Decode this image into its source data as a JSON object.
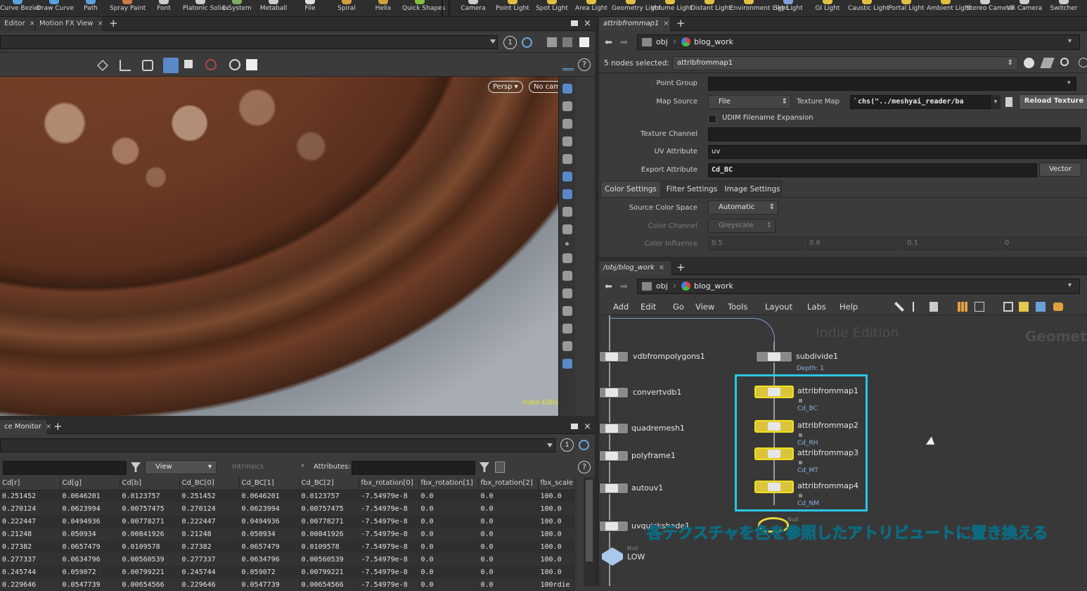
{
  "shelf": {
    "left_tools": [
      {
        "label": "Curve Bezier",
        "color": "#5aa0e0"
      },
      {
        "label": "Draw Curve",
        "color": "#5aa0e0"
      },
      {
        "label": "Path",
        "color": "#5aa0e0"
      },
      {
        "label": "Spray Paint",
        "color": "#d07840"
      },
      {
        "label": "Font",
        "color": "#cccccc"
      },
      {
        "label": "Platonic Solids",
        "color": "#cccccc"
      },
      {
        "label": "L-System",
        "color": "#7ab060"
      },
      {
        "label": "Metaball",
        "color": "#cccccc"
      },
      {
        "label": "File",
        "color": "#dddddd"
      },
      {
        "label": "Spiral",
        "color": "#d0a040"
      },
      {
        "label": "Helix",
        "color": "#d0a040"
      },
      {
        "label": "Quick Shapes",
        "color": "#80c040"
      }
    ],
    "right_tools": [
      {
        "label": "Camera",
        "color": "#cccccc"
      },
      {
        "label": "Point Light",
        "color": "#e0c040"
      },
      {
        "label": "Spot Light",
        "color": "#e0c040"
      },
      {
        "label": "Area Light",
        "color": "#e0c040"
      },
      {
        "label": "Geometry Light",
        "color": "#e0c040"
      },
      {
        "label": "Volume Light",
        "color": "#e0c040"
      },
      {
        "label": "Distant Light",
        "color": "#e0c040"
      },
      {
        "label": "Environment Light",
        "color": "#e0c040"
      },
      {
        "label": "Sky Light",
        "color": "#80a0e0"
      },
      {
        "label": "GI Light",
        "color": "#e0c040"
      },
      {
        "label": "Caustic Light",
        "color": "#e0c040"
      },
      {
        "label": "Portal Light",
        "color": "#e0c040"
      },
      {
        "label": "Ambient Light",
        "color": "#e0c040"
      },
      {
        "label": "Stereo Camera",
        "color": "#cccccc"
      },
      {
        "label": "VR Camera",
        "color": "#cccccc"
      },
      {
        "label": "Switcher",
        "color": "#cccccc"
      }
    ]
  },
  "viewer": {
    "tabs": [
      "Editor",
      "Motion FX View"
    ],
    "close_glyph": "×",
    "plus_glyph": "+",
    "view_number": "1",
    "persp_label": "Persp",
    "cam_label": "No cam",
    "watermark": "Indie Edition"
  },
  "spreadsheet": {
    "tab": "ce Monitor",
    "view_number": "1",
    "view_label": "View",
    "intrinsics_label": "Intrinsics",
    "attributes_label": "Attributes:",
    "columns": [
      "Cd[r]",
      "Cd[g]",
      "Cd[b]",
      "Cd_BC[0]",
      "Cd_BC[1]",
      "Cd_BC[2]",
      "fbx_rotation[0]",
      "fbx_rotation[1]",
      "fbx_rotation[2]",
      "fbx_scale"
    ],
    "rows": [
      [
        "0.251452",
        "0.0646201",
        "0.0123757",
        "0.251452",
        "0.0646201",
        "0.0123757",
        "-7.54979e-8",
        "0.0",
        "0.0",
        "100.0"
      ],
      [
        "0.270124",
        "0.0623994",
        "0.00757475",
        "0.270124",
        "0.0623994",
        "0.00757475",
        "-7.54979e-8",
        "0.0",
        "0.0",
        "100.0"
      ],
      [
        "0.222447",
        "0.0494936",
        "0.00778271",
        "0.222447",
        "0.0494936",
        "0.00778271",
        "-7.54979e-8",
        "0.0",
        "0.0",
        "100.0"
      ],
      [
        "0.21248",
        "0.050934",
        "0.00841926",
        "0.21248",
        "0.050934",
        "0.00841926",
        "-7.54979e-8",
        "0.0",
        "0.0",
        "100.0"
      ],
      [
        "0.27382",
        "0.0657479",
        "0.0109578",
        "0.27382",
        "0.0657479",
        "0.0109578",
        "-7.54979e-8",
        "0.0",
        "0.0",
        "100.0"
      ],
      [
        "0.277337",
        "0.0634796",
        "0.00560539",
        "0.277337",
        "0.0634796",
        "0.00560539",
        "-7.54979e-8",
        "0.0",
        "0.0",
        "100.0"
      ],
      [
        "0.245744",
        "0.059072",
        "0.00799221",
        "0.245744",
        "0.059072",
        "0.00799221",
        "-7.54979e-8",
        "0.0",
        "0.0",
        "100.0"
      ],
      [
        "0.229646",
        "0.0547739",
        "0.00654566",
        "0.229646",
        "0.0547739",
        "0.00654566",
        "-7.54979e-8",
        "0.0",
        "0.0",
        "100rdie"
      ]
    ]
  },
  "params": {
    "tab": "attribfrommap1",
    "path_obj": "obj",
    "path_geo": "blog_work",
    "selected_count": "5 nodes selected:",
    "selected_node": "attribfrommap1",
    "point_group_label": "Point Group",
    "map_source_label": "Map Source",
    "map_source_value": "File",
    "texture_map_label": "Texture Map",
    "texture_map_value": "`chs(\"../meshyai_reader/ba",
    "reload_texture": "Reload Texture",
    "udim_label": "UDIM Filename Expansion",
    "texture_channel_label": "Texture Channel",
    "uv_attribute_label": "UV Attribute",
    "uv_attribute_value": "uv",
    "export_attribute_label": "Export Attribute",
    "export_attribute_value": "Cd_BC",
    "vector_label": "Vector",
    "sub_tabs": [
      "Color Settings",
      "Filter Settings",
      "Image Settings"
    ],
    "source_color_space_label": "Source Color Space",
    "source_color_space_value": "Automatic",
    "color_channel_label": "Color Channel",
    "color_channel_value": "Greyscale",
    "color_influence_label": "Color Influence",
    "color_influence_values": [
      "0.5",
      "0.6",
      "0.1",
      "0"
    ]
  },
  "network": {
    "tab": "/obj/blog_work",
    "path_obj": "obj",
    "path_geo": "blog_work",
    "menus": [
      "Add",
      "Edit",
      "Go",
      "View",
      "Tools",
      "Layout",
      "Labs",
      "Help"
    ],
    "watermark": "Indie Edition",
    "context_label": "Geomet",
    "left_nodes": [
      "vdbfrompolygons1",
      "convertvdb1",
      "quadremesh1",
      "polyframe1",
      "autouv1",
      "uvquickshade1"
    ],
    "subdivide": {
      "name": "subdivide1",
      "info": "Depth: 1"
    },
    "selected_nodes": [
      {
        "name": "attribfrommap1",
        "attr": "Cd_BC"
      },
      {
        "name": "attribfrommap2",
        "attr": "Cd_RH"
      },
      {
        "name": "attribfrommap3",
        "attr": "Cd_MT"
      },
      {
        "name": "attribfrommap4",
        "attr": "Cd_NM"
      }
    ],
    "null_label": "Null",
    "low_label": "LOW",
    "annotation": "各テクスチャを色を参照したアトリビュートに置き換える",
    "highlight_color": "#29c6e6"
  }
}
